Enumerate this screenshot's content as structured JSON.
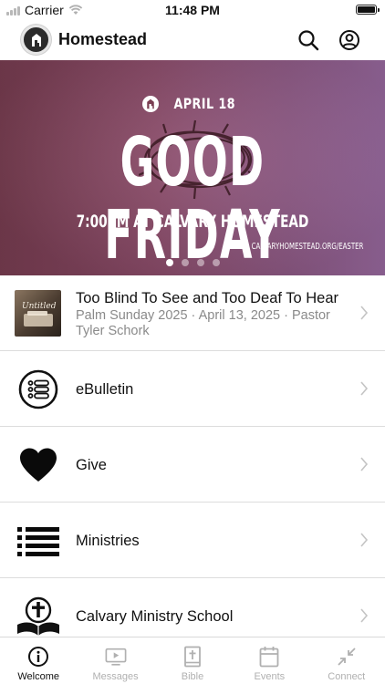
{
  "status_bar": {
    "carrier": "Carrier",
    "time": "11:48 PM"
  },
  "header": {
    "title": "Homestead"
  },
  "banner": {
    "date": "APRIL 18",
    "title": "GOOD FRIDAY",
    "subtitle": "7:00PM AT CALVARY HOMESTEAD",
    "url": "CALVARYHOMESTEAD.ORG/EASTER",
    "slide_count": 4,
    "active_slide": 1
  },
  "list": {
    "items": [
      {
        "title": "Too Blind To See and Too Deaf To Hear",
        "subtitle": "Palm Sunday 2025 · April 13, 2025 · Pastor Tyler Schork",
        "thumb_text": "Untitled"
      },
      {
        "title": "eBulletin",
        "icon": "bulletin-list-icon"
      },
      {
        "title": "Give",
        "icon": "heart-icon"
      },
      {
        "title": "Ministries",
        "icon": "list-icon"
      },
      {
        "title": "Calvary Ministry School",
        "icon": "bible-cross-icon"
      }
    ]
  },
  "tabbar": {
    "tabs": [
      {
        "label": "Welcome",
        "icon": "info-icon",
        "active": true
      },
      {
        "label": "Messages",
        "icon": "video-play-icon",
        "active": false
      },
      {
        "label": "Bible",
        "icon": "bible-icon",
        "active": false
      },
      {
        "label": "Events",
        "icon": "calendar-icon",
        "active": false
      },
      {
        "label": "Connect",
        "icon": "compress-arrows-icon",
        "active": false
      }
    ]
  },
  "colors": {
    "accent": "#111111",
    "inactive_tab": "#b0b0b0",
    "banner_start": "#7a3e52",
    "banner_end": "#9a6aa0"
  }
}
